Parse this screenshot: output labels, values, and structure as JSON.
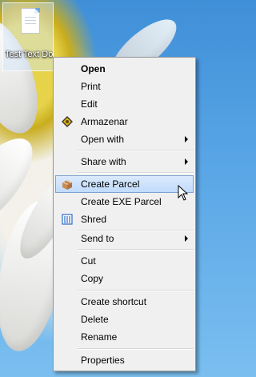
{
  "desktop": {
    "icon_label": "Test Text Document.txt"
  },
  "context_menu": {
    "items": [
      {
        "label": "Open",
        "bold": true
      },
      {
        "label": "Print"
      },
      {
        "label": "Edit"
      },
      {
        "label": "Armazenar",
        "icon": "armazenar-icon"
      },
      {
        "label": "Open with",
        "submenu": true
      },
      {
        "label": "Share with",
        "submenu": true
      },
      {
        "label": "Create Parcel",
        "icon": "parcel-icon",
        "highlighted": true
      },
      {
        "label": "Create EXE Parcel"
      },
      {
        "label": "Shred",
        "icon": "shred-icon"
      },
      {
        "label": "Send to",
        "submenu": true
      },
      {
        "label": "Cut"
      },
      {
        "label": "Copy"
      },
      {
        "label": "Create shortcut"
      },
      {
        "label": "Delete"
      },
      {
        "label": "Rename"
      },
      {
        "label": "Properties"
      }
    ]
  },
  "colors": {
    "highlight": "#c1dbfc",
    "highlight_border": "#7da2ce",
    "menu_bg": "#f0f0f0"
  }
}
